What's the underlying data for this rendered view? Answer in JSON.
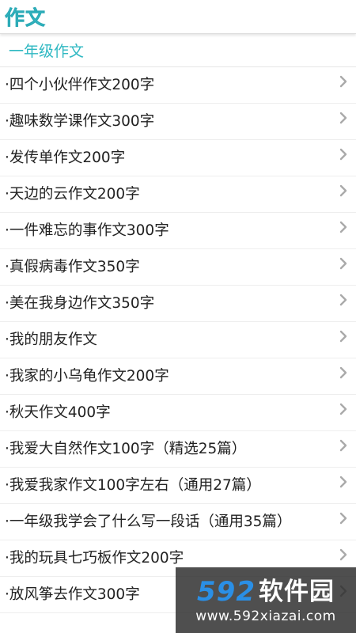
{
  "header": {
    "title": "作文",
    "accent_color": "#3bbec9"
  },
  "section": {
    "title": "一年级作文"
  },
  "list": {
    "items": [
      {
        "label": "·四个小伙伴作文200字"
      },
      {
        "label": "·趣味数学课作文300字"
      },
      {
        "label": "·发传单作文200字"
      },
      {
        "label": "·天边的云作文200字"
      },
      {
        "label": "·一件难忘的事作文300字"
      },
      {
        "label": "·真假病毒作文350字"
      },
      {
        "label": "·美在我身边作文350字"
      },
      {
        "label": "·我的朋友作文"
      },
      {
        "label": "·我家的小乌龟作文200字"
      },
      {
        "label": "·秋天作文400字"
      },
      {
        "label": "·我爱大自然作文100字（精选25篇）"
      },
      {
        "label": "·我爱我家作文100字左右（通用27篇）"
      },
      {
        "label": "·一年级我学会了什么写一段话（通用35篇）"
      },
      {
        "label": "·我的玩具七巧板作文200字"
      },
      {
        "label": "·放风筝去作文300字"
      }
    ],
    "chevron_icon": "chevron-right-icon"
  },
  "watermark": {
    "number": "592",
    "name": "软件园",
    "url": "www.592xiazai.com"
  }
}
